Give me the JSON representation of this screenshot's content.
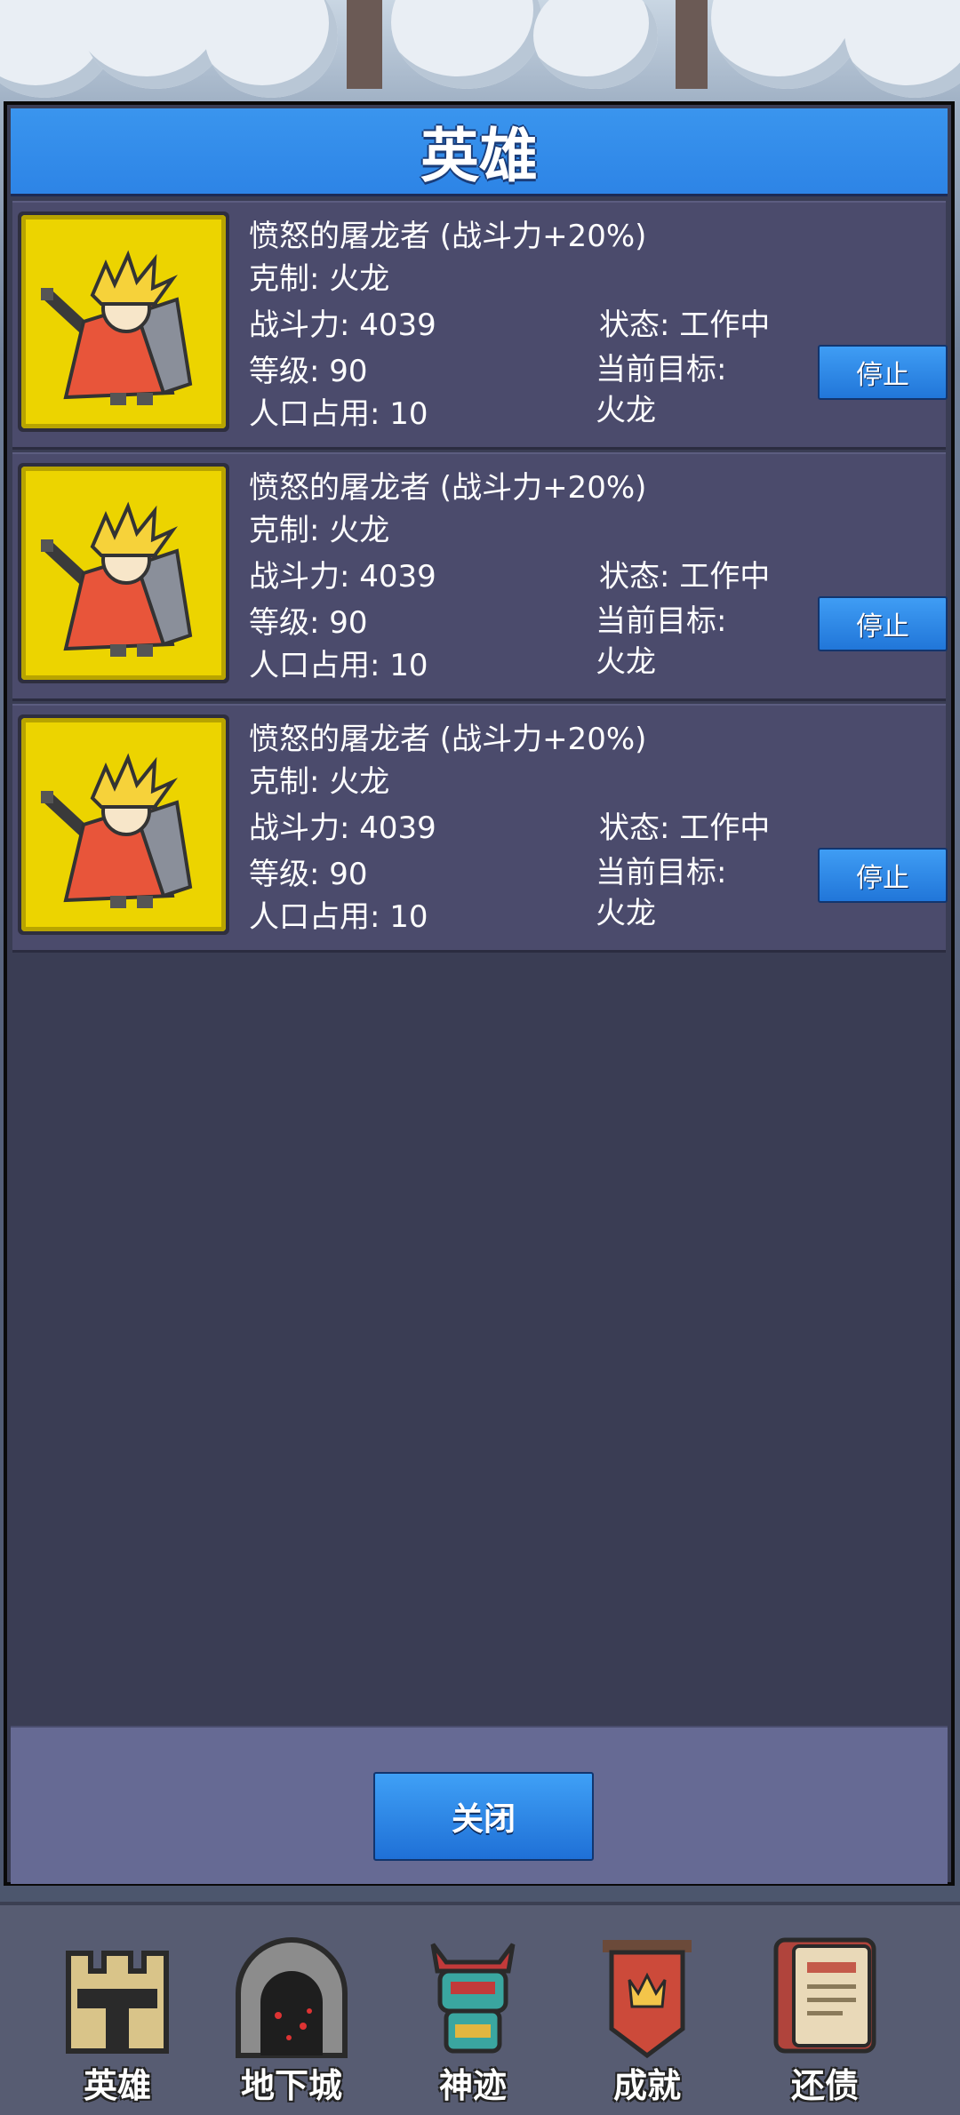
{
  "dialog": {
    "title": "英雄"
  },
  "heroes": [
    {
      "name": "愤怒的屠龙者 (战斗力+20%)",
      "counter": "克制: 火龙",
      "power": "战斗力: 4039",
      "level": "等级: 90",
      "population": "人口占用: 10",
      "status": "状态: 工作中",
      "target_label": "当前目标:",
      "target": "火龙",
      "action": "停止"
    },
    {
      "name": "愤怒的屠龙者 (战斗力+20%)",
      "counter": "克制: 火龙",
      "power": "战斗力: 4039",
      "level": "等级: 90",
      "population": "人口占用: 10",
      "status": "状态: 工作中",
      "target_label": "当前目标:",
      "target": "火龙",
      "action": "停止"
    },
    {
      "name": "愤怒的屠龙者 (战斗力+20%)",
      "counter": "克制: 火龙",
      "power": "战斗力: 4039",
      "level": "等级: 90",
      "population": "人口占用: 10",
      "status": "状态: 工作中",
      "target_label": "当前目标:",
      "target": "火龙",
      "action": "停止"
    }
  ],
  "footer": {
    "close_label": "关闭"
  },
  "nav": [
    {
      "label": "英雄",
      "icon": "castle-icon"
    },
    {
      "label": "地下城",
      "icon": "dungeon-gate-icon"
    },
    {
      "label": "神迹",
      "icon": "totem-idol-icon"
    },
    {
      "label": "成就",
      "icon": "crown-banner-icon"
    },
    {
      "label": "还债",
      "icon": "ledger-book-icon"
    }
  ],
  "colors": {
    "header": "#2d84e6",
    "panel": "#3a3d54",
    "row": "#4b4b6c",
    "portrait_bg": "#ecd400",
    "footer": "#666a94"
  }
}
